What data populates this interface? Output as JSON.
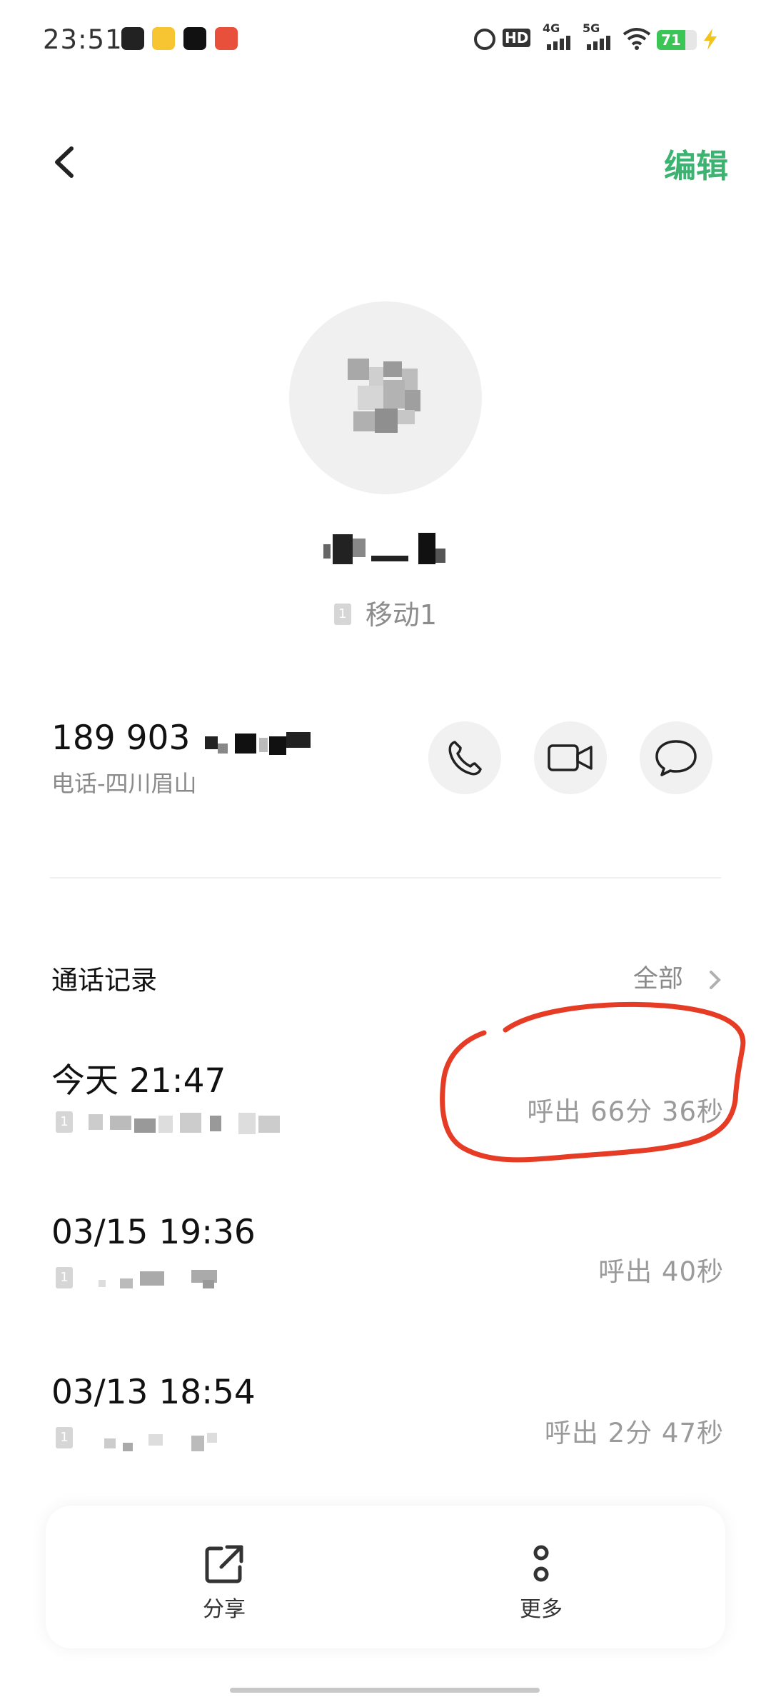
{
  "status_bar": {
    "time": "23:51",
    "network_labels": [
      "HD",
      "4G",
      "5G"
    ],
    "battery": "71"
  },
  "header": {
    "back_icon": "chevron-left-icon",
    "edit_label": "编辑"
  },
  "contact": {
    "sim_badge": "1",
    "sim_label": "移动1"
  },
  "phone": {
    "number_visible": "189 903",
    "label": "电话-四川眉山",
    "actions": [
      {
        "name": "call",
        "icon": "phone-icon"
      },
      {
        "name": "video",
        "icon": "video-camera-icon"
      },
      {
        "name": "message",
        "icon": "message-bubble-icon"
      }
    ]
  },
  "call_log": {
    "title": "通话记录",
    "all_label": "全部",
    "entries": [
      {
        "time": "今天 21:47",
        "duration": "呼出 66分 36秒",
        "sub_visible": "1"
      },
      {
        "time": "03/15 19:36",
        "duration": "呼出 40秒",
        "sub_visible": "1"
      },
      {
        "time": "03/13 18:54",
        "duration": "呼出 2分 47秒",
        "sub_visible": "1"
      }
    ]
  },
  "bottom_bar": {
    "share_label": "分享",
    "more_label": "更多"
  },
  "colors": {
    "accent_green": "#3cb371",
    "annotation_red": "#e63b24"
  }
}
